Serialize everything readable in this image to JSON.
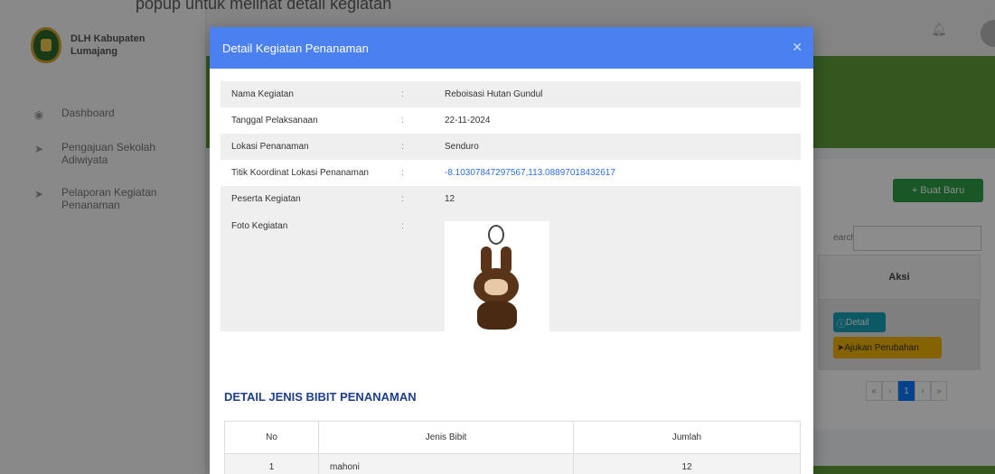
{
  "top_partial_text": "popup untuk melihat detail kegiatan",
  "sidebar": {
    "brand": "DLH Kabupaten Lumajang",
    "items": [
      {
        "label": "Dashboard",
        "icon": "dashboard-icon"
      },
      {
        "label": "Pengajuan Sekolah Adiwiyata",
        "icon": "send-icon"
      },
      {
        "label": "Pelaporan Kegiatan Penanaman",
        "icon": "send-icon"
      }
    ]
  },
  "background": {
    "new_button": "+ Buat Baru",
    "search_label": "earch:",
    "aksi_header": "Aksi",
    "detail_button": "Detail",
    "ajukan_button": "Ajukan Perubahan",
    "pager": [
      "«",
      "‹",
      "1",
      "›",
      "»"
    ]
  },
  "modal": {
    "title": "Detail Kegiatan Penanaman",
    "rows": [
      {
        "label": "Nama Kegiatan",
        "sep": ":",
        "value": "Reboisasi Hutan Gundul"
      },
      {
        "label": "Tanggal Pelaksanaan",
        "sep": ":",
        "value": "22-11-2024"
      },
      {
        "label": "Lokasi Penanaman",
        "sep": ":",
        "value": "Senduro"
      },
      {
        "label": "Titik Koordinat Lokasi Penanaman",
        "sep": ":",
        "value": "-8.10307847297567,113.08897018432617"
      },
      {
        "label": "Peserta Kegiatan",
        "sep": ":",
        "value": "12"
      }
    ],
    "photo_label": "Foto Kegiatan",
    "photo_sep": ":",
    "section_title": "DETAIL JENIS BIBIT PENANAMAN",
    "table": {
      "headers": [
        "No",
        "Jenis Bibit",
        "Jumlah"
      ],
      "rows": [
        [
          "1",
          "mahoni",
          "12"
        ]
      ]
    }
  }
}
